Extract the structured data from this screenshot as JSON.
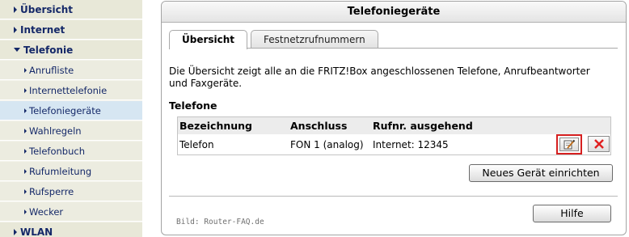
{
  "sidebar": {
    "items": [
      {
        "label": "Übersicht"
      },
      {
        "label": "Internet"
      },
      {
        "label": "Telefonie"
      },
      {
        "label": "Anrufliste"
      },
      {
        "label": "Internettelefonie"
      },
      {
        "label": "Telefoniegeräte"
      },
      {
        "label": "Wahlregeln"
      },
      {
        "label": "Telefonbuch"
      },
      {
        "label": "Rufumleitung"
      },
      {
        "label": "Rufsperre"
      },
      {
        "label": "Wecker"
      },
      {
        "label": "WLAN"
      }
    ],
    "active": "Telefoniegeräte"
  },
  "panel": {
    "title": "Telefoniegeräte",
    "tabs": [
      {
        "label": "Übersicht"
      },
      {
        "label": "Festnetzrufnummern"
      }
    ],
    "description": "Die Übersicht zeigt alle an die FRITZ!Box angeschlossenen Telefone, Anrufbeantworter und Faxgeräte.",
    "section_title": "Telefone",
    "table": {
      "columns": [
        "Bezeichnung",
        "Anschluss",
        "Rufnr. ausgehend"
      ],
      "rows": [
        {
          "name": "Telefon",
          "port": "FON 1 (analog)",
          "outgoing": "Internet: 12345"
        }
      ]
    },
    "new_device_label": "Neues Gerät einrichten",
    "help_label": "Hilfe",
    "credit": "Bild: Router-FAQ.de"
  },
  "colors": {
    "nav_text": "#142868",
    "nav_bg": "#e8e8d8",
    "nav_active_bg": "#d6e6f2",
    "highlight_border": "#d62020",
    "delete_x": "#e02020"
  }
}
